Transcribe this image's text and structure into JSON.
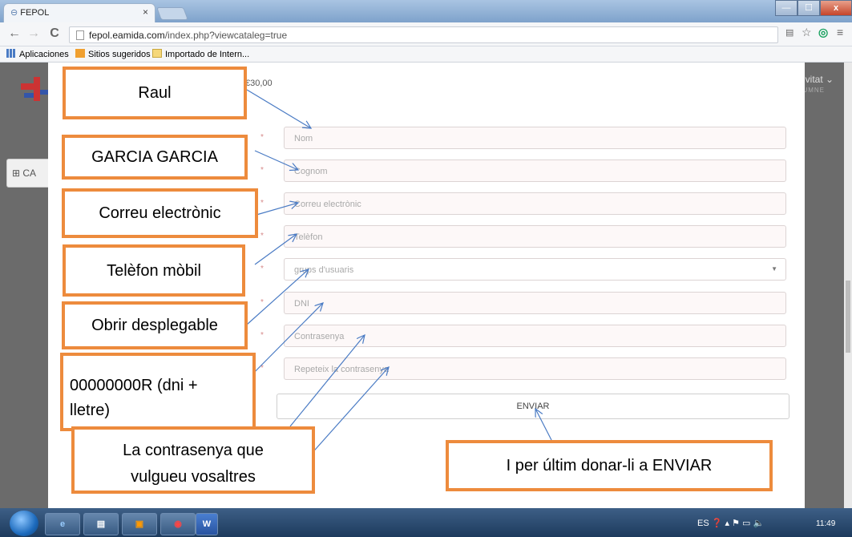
{
  "browser": {
    "tab_title": "FEPOL",
    "tab_close": "×",
    "url_domain": "fepol.eamida.com",
    "url_path": "/index.php?viewcataleg=true",
    "bookmarks": [
      "Aplicaciones",
      "Sitios sugeridos",
      "Importado de Intern..."
    ],
    "window_buttons": {
      "close": "x"
    }
  },
  "page": {
    "category_label": "CA",
    "header_right": "nvitat",
    "header_right_sub": "LUMNE",
    "price": "€30,00",
    "form": {
      "required_marker": "*",
      "nom_placeholder": "Nom",
      "cognom_placeholder": "Cognom",
      "correu_placeholder": "Correu electrònic",
      "telefon_placeholder": "Telèfon",
      "grups_placeholder": "grups d'usuaris",
      "dni_placeholder": "DNI",
      "contrasenya_placeholder": "Contrasenya",
      "repeteix_placeholder": "Repeteix la contrasenya",
      "submit_label": "ENVIAR"
    }
  },
  "annotations": {
    "raul": "Raul",
    "garcia": "GARCIA GARCIA",
    "correu": "Correu electrònic",
    "telefon": "Telèfon mòbil",
    "obrir": "Obrir desplegable",
    "dni_line1": "00000000R (dni +",
    "dni_line2": "lletre)",
    "pass_line1": "La contrasenya que",
    "pass_line2": "vulgueu vosaltres",
    "enviar": "I per últim donar-li a ENVIAR"
  },
  "taskbar": {
    "language": "ES",
    "clock": "11:49"
  },
  "colors": {
    "callout_border": "#ed8b3d",
    "arrow": "#4a7bc4"
  }
}
